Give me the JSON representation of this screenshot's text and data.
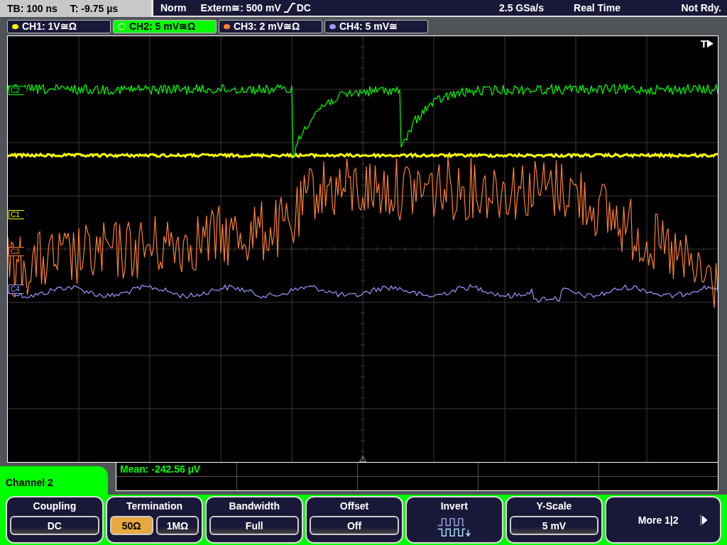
{
  "status_bar": {
    "timebase": "TB: 100 ns",
    "trigger_time": "T: -9.75 µs",
    "trigger_mode": "Norm",
    "trigger_source": "Extern≅: 500 mV",
    "trigger_coupling": "DC",
    "sample_rate": "2.5 GSa/s",
    "acquisition": "Real Time",
    "state": "Not Rdy."
  },
  "channels": [
    {
      "label": "CH1: 1V≅Ω",
      "color": "#ffff00",
      "selected": false
    },
    {
      "label": "CH2: 5 mV≅Ω",
      "color": "#00ff00",
      "selected": true
    },
    {
      "label": "CH3: 2 mV≅Ω",
      "color": "#ff8030",
      "selected": false
    },
    {
      "label": "CH4: 5 mV≅",
      "color": "#9a9aff",
      "selected": false
    }
  ],
  "display": {
    "trigger_marker": "T",
    "channel_markers": [
      {
        "label": "C2",
        "color": "#00ff00"
      },
      {
        "label": "C1",
        "color": "#ffff00"
      },
      {
        "label": "C3",
        "color": "#ff8030"
      },
      {
        "label": "C4",
        "color": "#9a9aff"
      }
    ]
  },
  "measurement": {
    "label": "Mean: -242.56 µV"
  },
  "menu": {
    "title": "Channel 2",
    "softkeys": [
      {
        "kind": "value",
        "label": "Coupling",
        "value": "DC"
      },
      {
        "kind": "choice",
        "label": "Termination",
        "options": [
          {
            "label": "50Ω",
            "selected": true
          },
          {
            "label": "1MΩ",
            "selected": false
          }
        ]
      },
      {
        "kind": "value",
        "label": "Bandwidth",
        "value": "Full"
      },
      {
        "kind": "value",
        "label": "Offset",
        "value": "Off"
      },
      {
        "kind": "icon",
        "label": "Invert"
      },
      {
        "kind": "value",
        "label": "Y-Scale",
        "value": "5 mV"
      },
      {
        "kind": "more",
        "label": "More 1|2"
      }
    ]
  }
}
